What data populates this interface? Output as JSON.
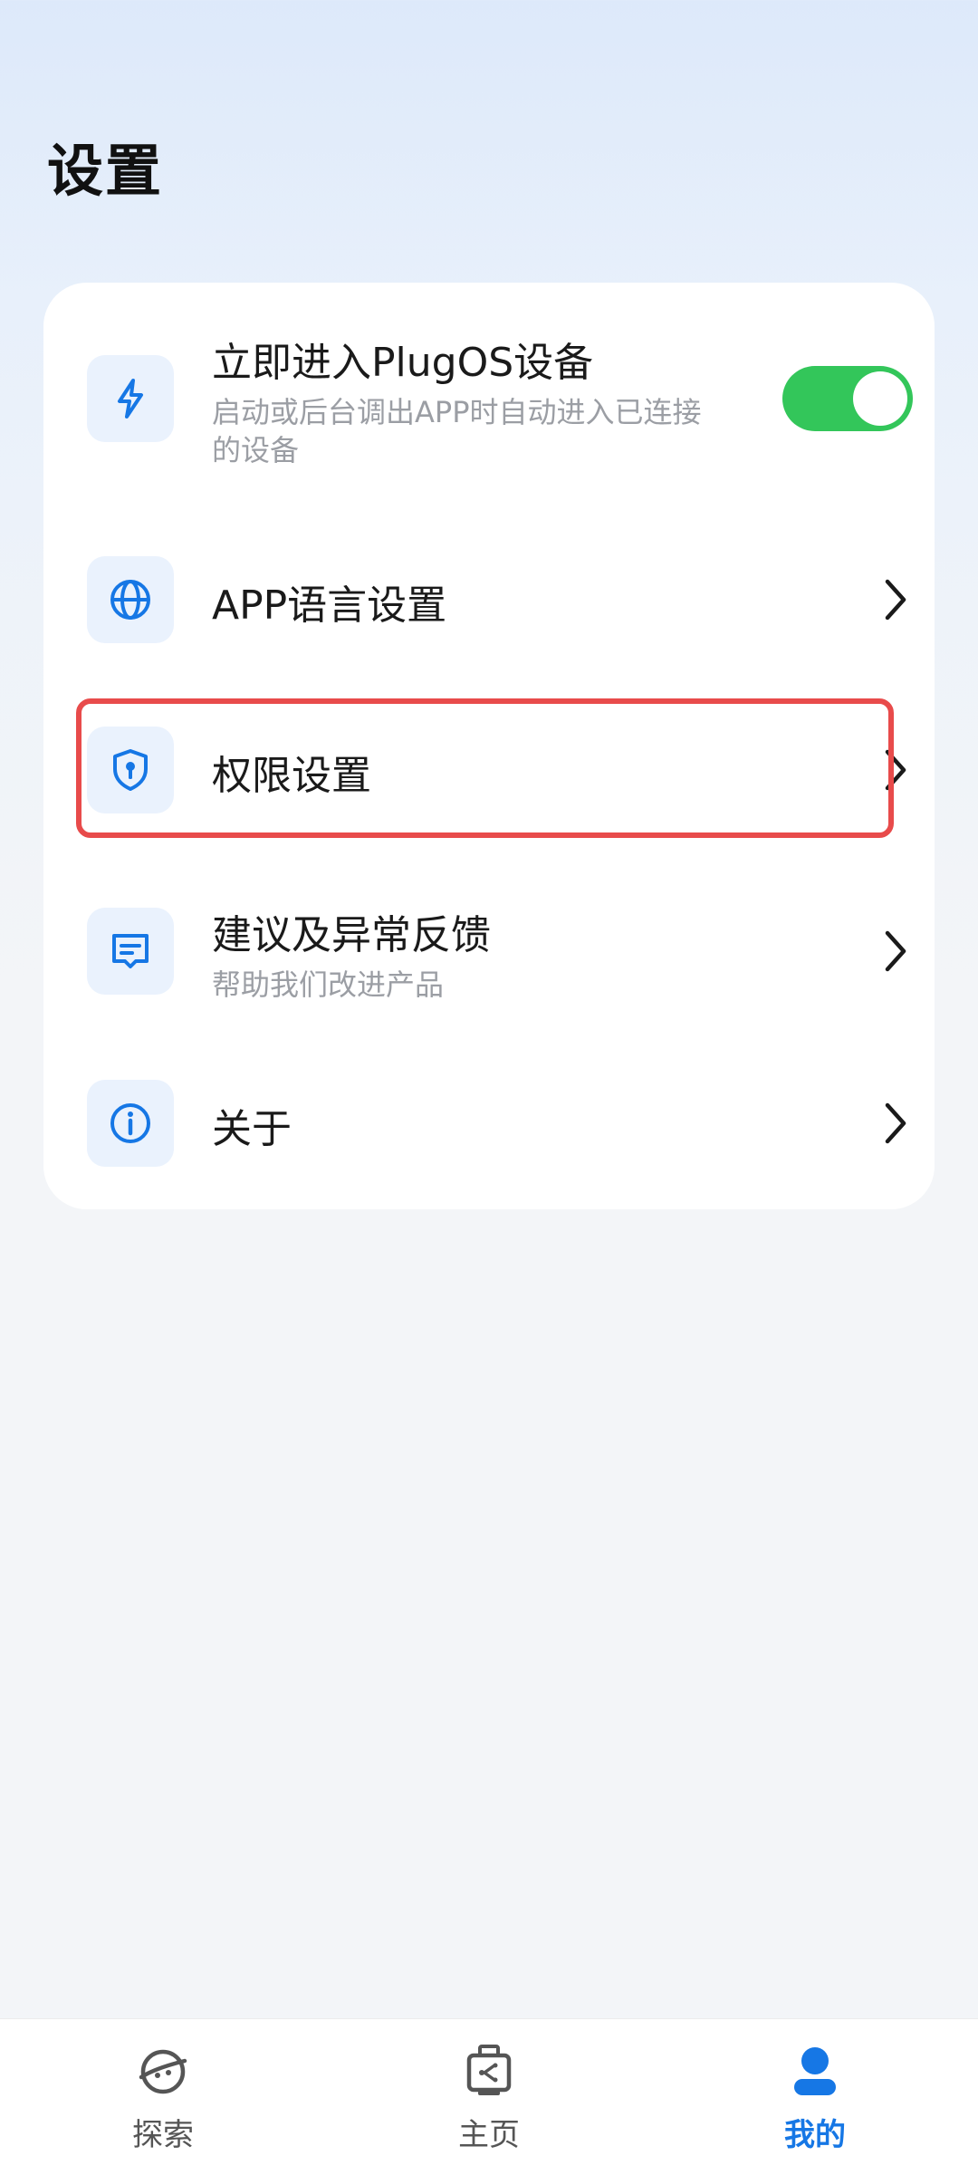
{
  "page": {
    "title": "设置"
  },
  "settings": {
    "auto_enter": {
      "title": "立即进入PlugOS设备",
      "subtitle": "启动或后台调出APP时自动进入已连接的设备",
      "toggle_on": true,
      "icon": "lightning-icon"
    },
    "language": {
      "title": "APP语言设置",
      "icon": "globe-icon"
    },
    "permissions": {
      "title": "权限设置",
      "icon": "shield-lock-icon",
      "highlighted": true
    },
    "feedback": {
      "title": "建议及异常反馈",
      "subtitle": "帮助我们改进产品",
      "icon": "message-icon"
    },
    "about": {
      "title": "关于",
      "icon": "info-icon"
    }
  },
  "tabbar": {
    "explore": {
      "label": "探索",
      "icon": "planet-icon"
    },
    "home": {
      "label": "主页",
      "icon": "device-icon"
    },
    "mine": {
      "label": "我的",
      "icon": "person-icon",
      "active": true
    }
  },
  "colors": {
    "accent": "#1677e5",
    "toggle_on": "#33c65a",
    "highlight_border": "#e84b4b",
    "icon_bg": "#eaf2fd",
    "subtitle": "#9b9ea4"
  }
}
